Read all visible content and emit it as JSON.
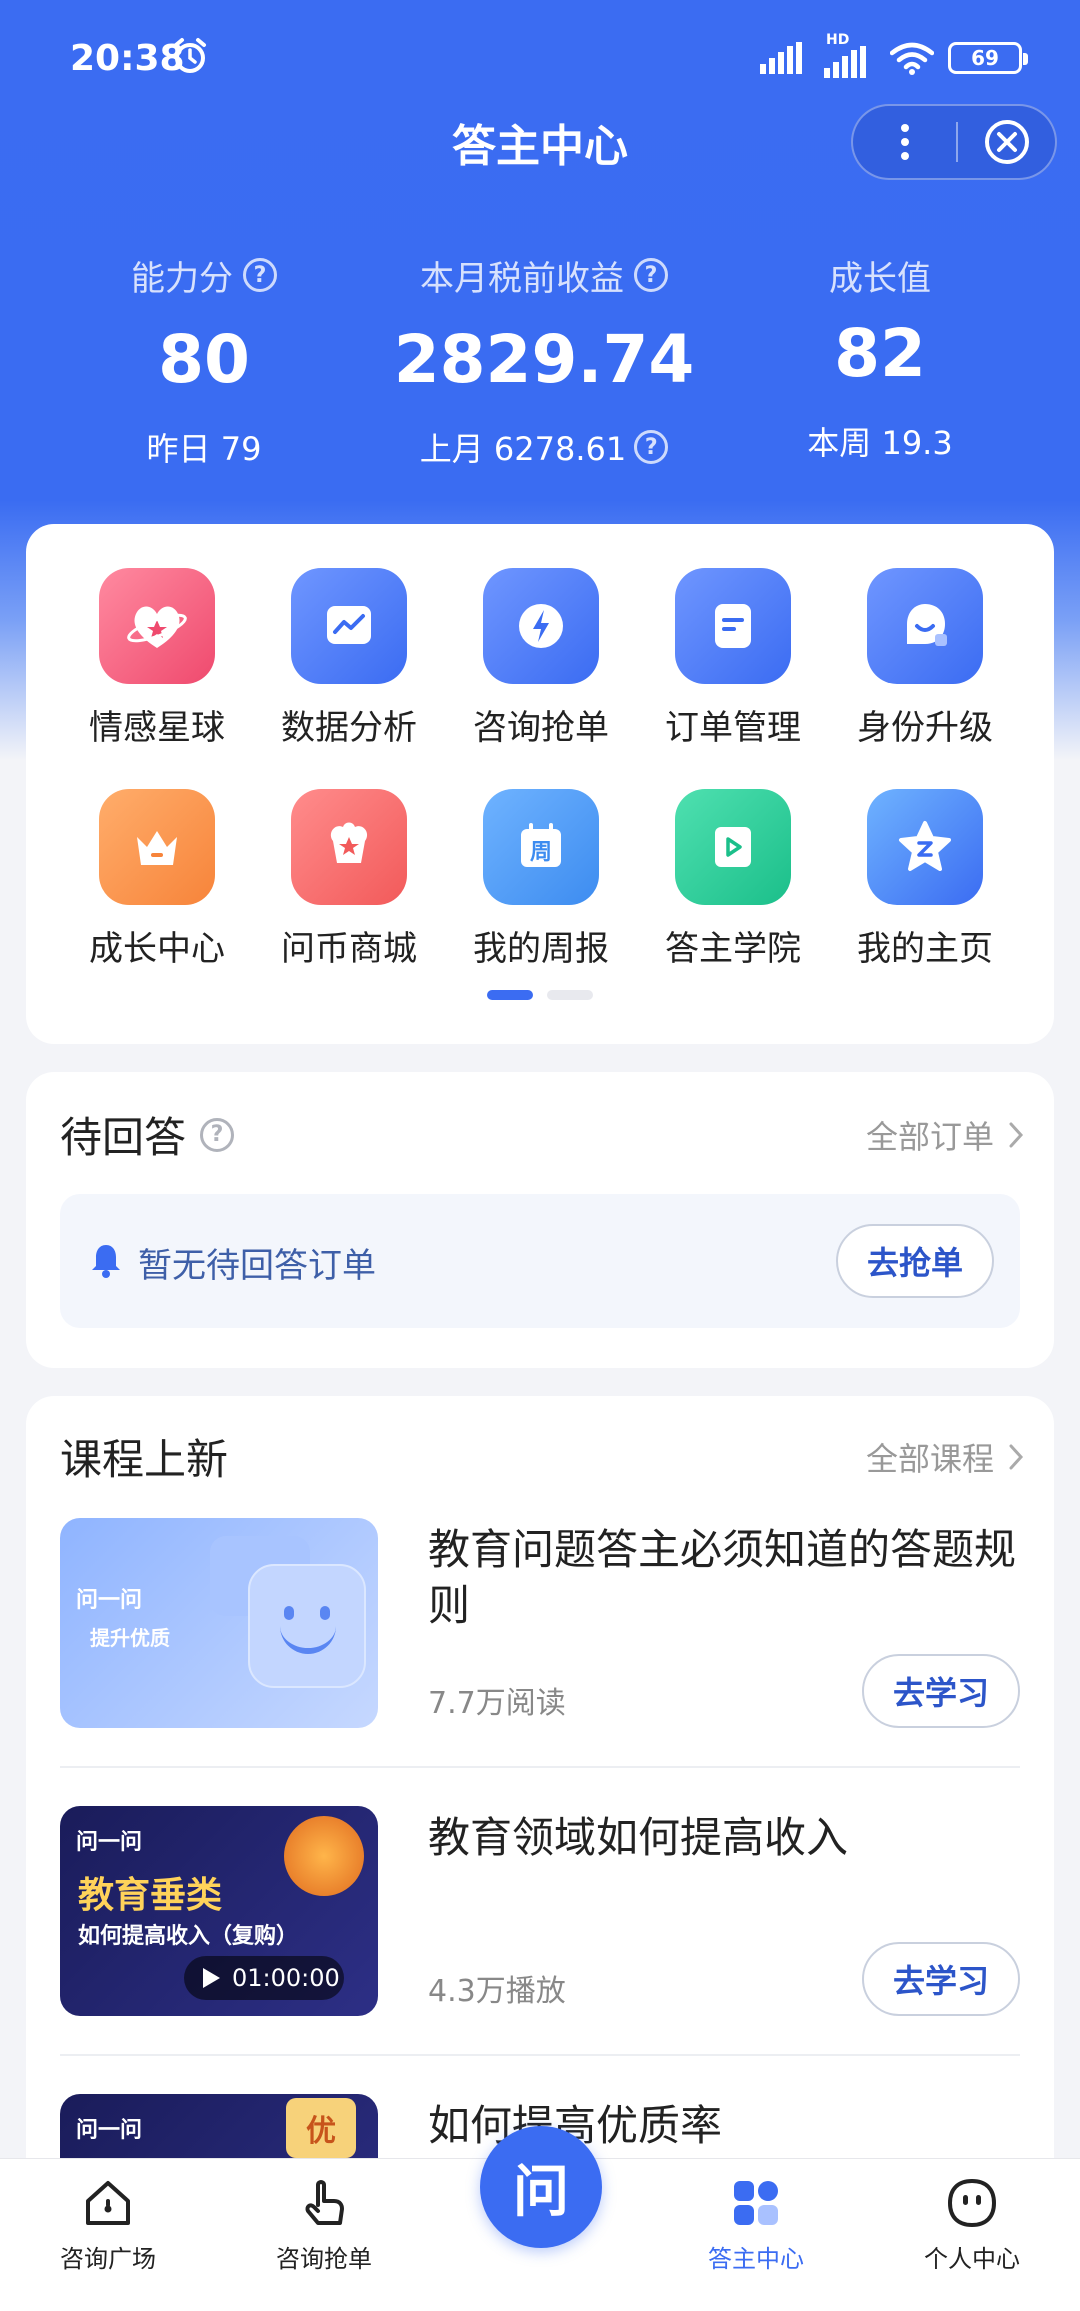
{
  "status_bar": {
    "time": "20:38",
    "battery": "69",
    "network": "HD"
  },
  "header": {
    "title": "答主中心"
  },
  "stats": [
    {
      "label": "能力分",
      "value": "80",
      "sub": "昨日 79"
    },
    {
      "label": "本月税前收益",
      "value": "2829.74",
      "sub": "上月 6278.61"
    },
    {
      "label": "成长值",
      "value": "82",
      "sub": "本周 19.3"
    }
  ],
  "grid": {
    "items": [
      {
        "label": "情感星球",
        "icon": "heart-planet-icon",
        "color": "#f25a78"
      },
      {
        "label": "数据分析",
        "icon": "chart-icon",
        "color": "#3b6cf2"
      },
      {
        "label": "咨询抢单",
        "icon": "lightning-icon",
        "color": "#3b6cf2"
      },
      {
        "label": "订单管理",
        "icon": "document-icon",
        "color": "#3b6cf2"
      },
      {
        "label": "身份升级",
        "icon": "user-badge-icon",
        "color": "#3b6cf2"
      },
      {
        "label": "成长中心",
        "icon": "crown-icon",
        "color": "#f7843a"
      },
      {
        "label": "问币商城",
        "icon": "shop-star-icon",
        "color": "#f25a5a"
      },
      {
        "label": "我的周报",
        "icon": "calendar-icon",
        "color": "#3d8cf0",
        "glyph": "周"
      },
      {
        "label": "答主学院",
        "icon": "play-book-icon",
        "color": "#1bbf8a"
      },
      {
        "label": "我的主页",
        "icon": "star-profile-icon",
        "color": "#3b6cf2"
      }
    ],
    "page_count": 2,
    "active_page": 1
  },
  "pending": {
    "title": "待回答",
    "link": "全部订单",
    "empty_text": "暂无待回答订单",
    "button": "去抢单"
  },
  "courses": {
    "title": "课程上新",
    "link": "全部课程",
    "items": [
      {
        "title": "教育问题答主必须知道的答题规则",
        "meta": "7.7万阅读",
        "button": "去学习",
        "thumb_brand": "问一问",
        "thumb_text": "提升优质"
      },
      {
        "title": "教育领域如何提高收入",
        "meta": "4.3万播放",
        "button": "去学习",
        "thumb_brand": "问一问",
        "thumb_text": "教育垂类",
        "thumb_sub": "如何提高收入（复购）",
        "duration": "01:00:00"
      },
      {
        "title": "如何提高优质率",
        "thumb_brand": "问一问",
        "thumb_badge": "优"
      }
    ]
  },
  "tabbar": {
    "tabs": [
      {
        "label": "咨询广场",
        "icon": "home-icon"
      },
      {
        "label": "咨询抢单",
        "icon": "tap-hand-icon"
      },
      {
        "label": "问",
        "icon": "ask-icon"
      },
      {
        "label": "答主中心",
        "icon": "grid-icon",
        "active": true
      },
      {
        "label": "个人中心",
        "icon": "face-icon"
      }
    ]
  },
  "colors": {
    "primary": "#3b6cf2",
    "background": "#f3f4f8"
  }
}
